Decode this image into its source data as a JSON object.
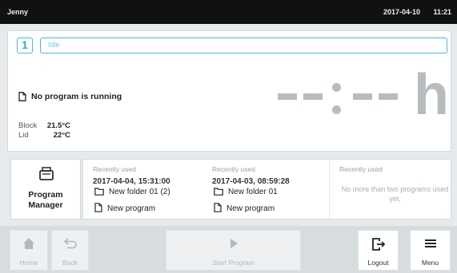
{
  "topbar": {
    "user": "Jenny",
    "date": "2017-04-10",
    "time": "11:21"
  },
  "status": {
    "block_number": "1",
    "state": "Idle",
    "program_message": "No program is running",
    "timer": {
      "hours_unit": "h"
    },
    "temperatures": [
      {
        "label": "Block",
        "value": "21.5°C"
      },
      {
        "label": "Lid",
        "value": "22°C"
      }
    ]
  },
  "program_manager": {
    "line1": "Program",
    "line2": "Manager",
    "icon": "program-manager-icon"
  },
  "recent": [
    {
      "header": "Recently used",
      "timestamp": "2017-04-04, 15:31:00",
      "folder": "New folder 01 (2)",
      "program": "New program"
    },
    {
      "header": "Recently used",
      "timestamp": "2017-04-03, 08:59:28",
      "folder": "New folder 01",
      "program": "New program"
    }
  ],
  "recent_empty": {
    "header": "Recently used",
    "message": "No more than two programs used yet."
  },
  "nav": {
    "home": "Home",
    "back": "Back",
    "start": "Start Program",
    "logout": "Logout",
    "menu": "Menu"
  },
  "colors": {
    "accent": "#4cb5e3",
    "timer_gray": "#b9bcbf",
    "topbar": "#111111"
  }
}
